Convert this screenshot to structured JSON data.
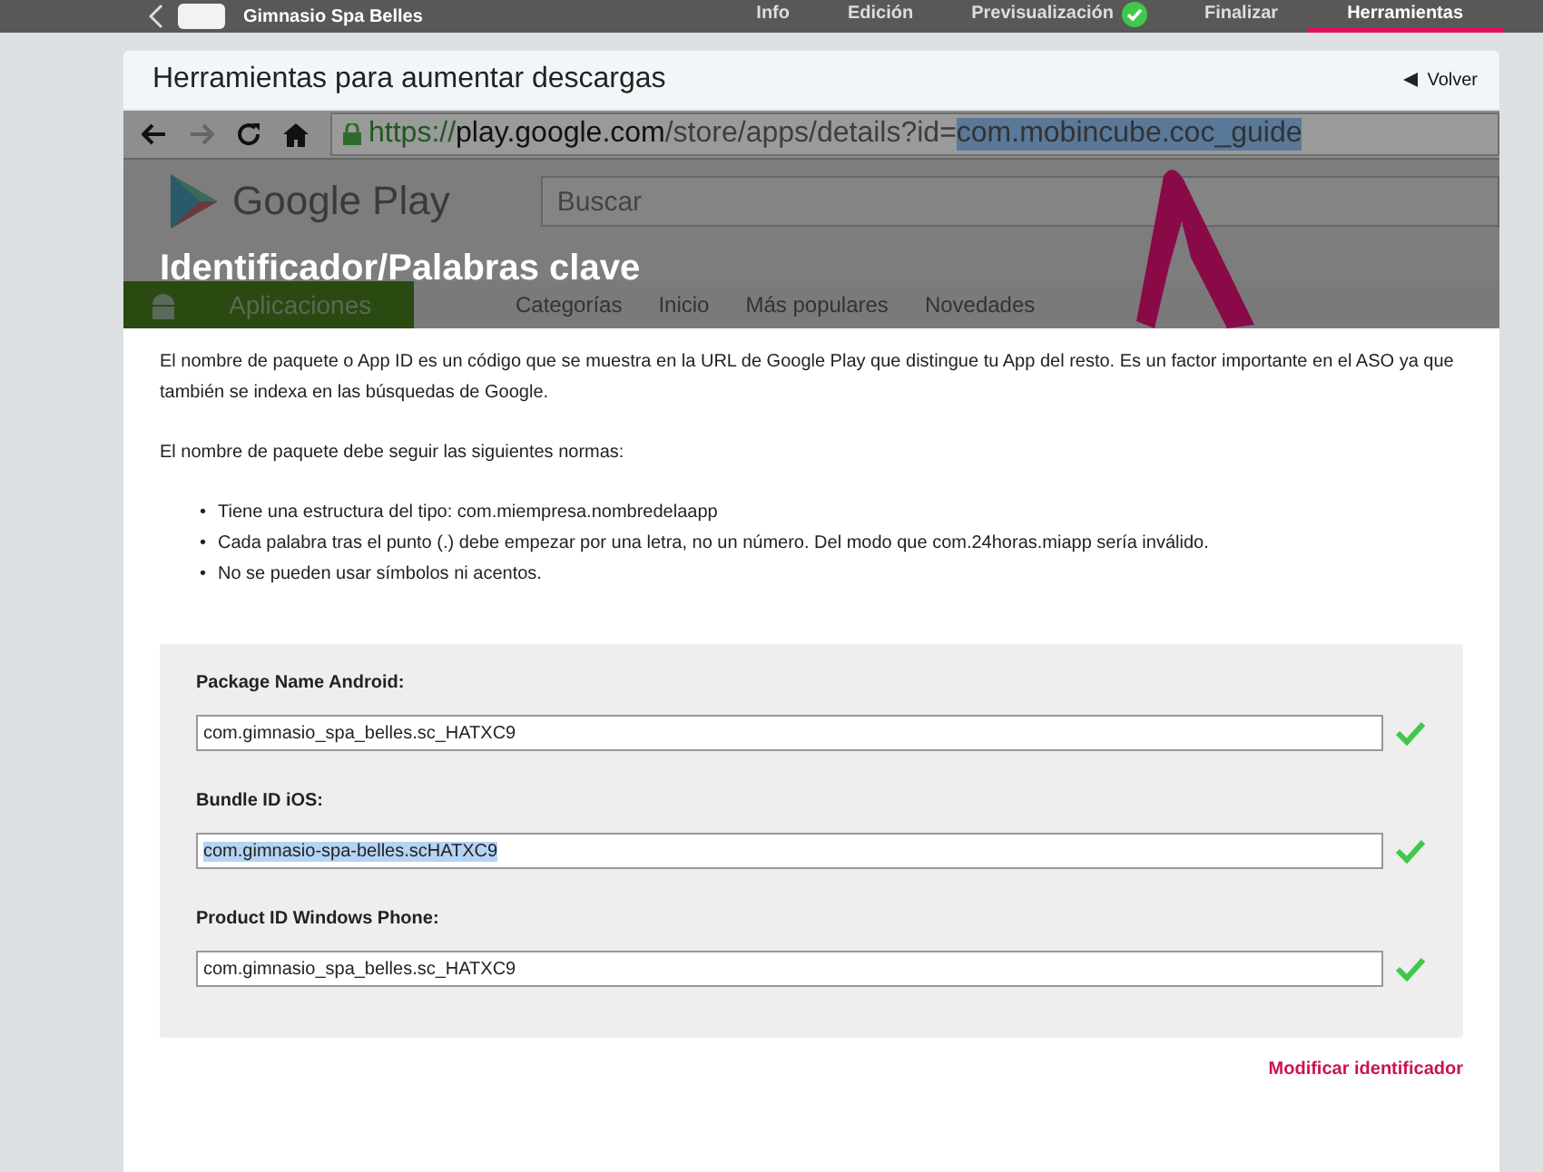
{
  "topbar": {
    "app_name": "Gimnasio Spa Belles",
    "tabs": [
      {
        "label": "Info",
        "selected": false,
        "verified": false
      },
      {
        "label": "Edición",
        "selected": false,
        "verified": false
      },
      {
        "label": "Previsualización",
        "selected": false,
        "verified": true
      },
      {
        "label": "Finalizar",
        "selected": false,
        "verified": false
      },
      {
        "label": "Herramientas",
        "selected": true,
        "verified": false
      }
    ]
  },
  "card": {
    "title": "Herramientas para aumentar descargas",
    "back_link": "Volver"
  },
  "banner": {
    "title": "Identificador/Palabras clave",
    "browser": {
      "url_scheme": "https://",
      "url_host": "play.google.com",
      "url_path": "/store/apps/details?id=",
      "url_selected": "com.mobincube.coc_guide",
      "store_name": "Google Play",
      "search_placeholder": "Buscar",
      "category": "Aplicaciones",
      "nav": [
        "Categorías",
        "Inicio",
        "Más populares",
        "Novedades"
      ]
    }
  },
  "intro": "El nombre de paquete o App ID es un código que se muestra en la URL de Google Play que distingue tu App del resto. Es un factor importante en el ASO ya que también se indexa en las búsquedas de Google.",
  "rules_intro": "El nombre de paquete debe seguir las siguientes normas:",
  "rules": [
    {
      "bullet": "•",
      "text": "Tiene una estructura del tipo: com.miempresa.nombredelaapp"
    },
    {
      "bullet": "•",
      "text": "Cada palabra tras el punto (.) debe empezar por una letra, no un número. Del modo que com.24horas.miapp sería inválido."
    },
    {
      "bullet": "•",
      "text": "No se pueden usar símbolos ni acentos."
    }
  ],
  "fields": [
    {
      "label": "Package Name Android:",
      "value": "com.gimnasio_spa_belles.sc_HATXC9",
      "valid": true,
      "text_selected": false
    },
    {
      "label": "Bundle ID iOS:",
      "value": "com.gimnasio-spa-belles.scHATXC9",
      "valid": true,
      "text_selected": true
    },
    {
      "label": "Product ID Windows Phone:",
      "value": "com.gimnasio_spa_belles.sc_HATXC9",
      "valid": true,
      "text_selected": false
    }
  ],
  "modify_link": "Modificar identificador"
}
